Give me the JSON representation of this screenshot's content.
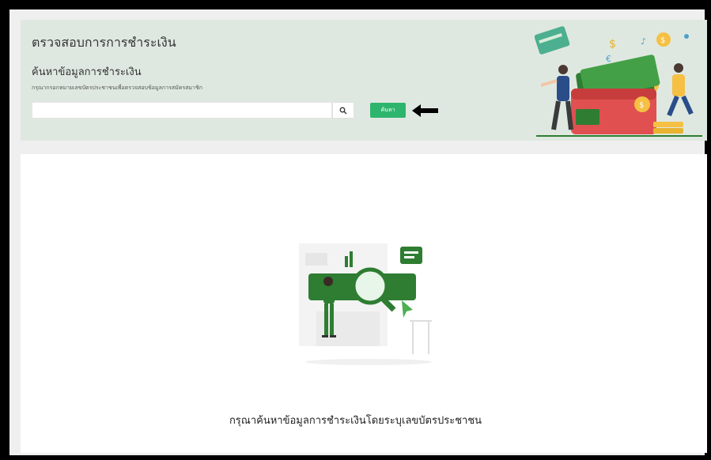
{
  "header": {
    "title": "ตรวจสอบการการชำระเงิน",
    "section_title": "ค้นหาข้อมูลการชำระเงิน",
    "hint": "กรุณากรอกหมายเลขบัตรประชาชนเพื่อตรวจสอบข้อมูลการสมัครสมาชิก"
  },
  "search": {
    "value": "",
    "placeholder": "",
    "button_label": "ค้นหา",
    "icon": "search-icon"
  },
  "main": {
    "empty_message": "กรุณาค้นหาข้อมูลการชำระเงินโดยระบุเลขบัตรประชาชน"
  },
  "colors": {
    "header_bg": "#dfe8e0",
    "accent": "#2eb56d",
    "illustration_green": "#2e7d32"
  }
}
